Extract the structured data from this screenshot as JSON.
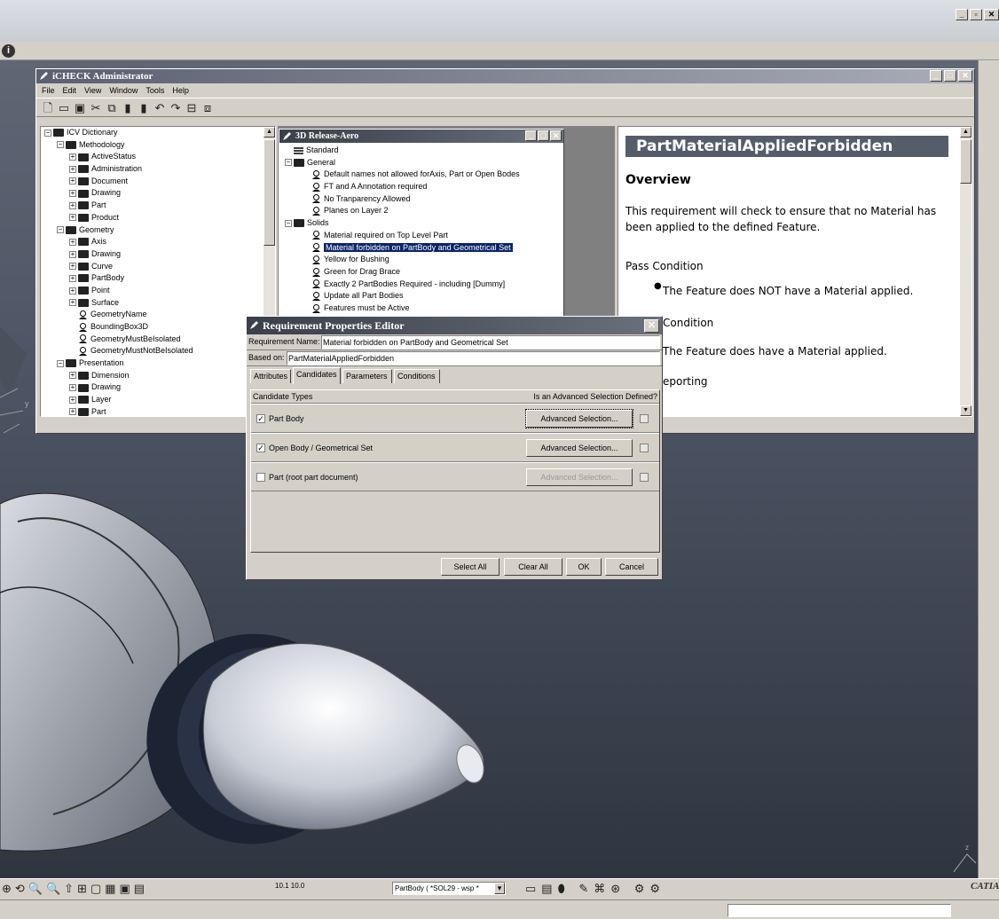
{
  "admin": {
    "title": "iCHECK Administrator",
    "menu": [
      "File",
      "Edit",
      "View",
      "Window",
      "Tools",
      "Help"
    ],
    "tree": [
      {
        "label": "ICV Dictionary",
        "depth": 0,
        "exp": "-",
        "icon": "folder"
      },
      {
        "label": "Methodology",
        "depth": 1,
        "exp": "-",
        "icon": "folder"
      },
      {
        "label": "ActiveStatus",
        "depth": 2,
        "exp": "+",
        "icon": "folder"
      },
      {
        "label": "Administration",
        "depth": 2,
        "exp": "+",
        "icon": "folder"
      },
      {
        "label": "Document",
        "depth": 2,
        "exp": "+",
        "icon": "folder"
      },
      {
        "label": "Drawing",
        "depth": 2,
        "exp": "+",
        "icon": "folder"
      },
      {
        "label": "Part",
        "depth": 2,
        "exp": "+",
        "icon": "folder"
      },
      {
        "label": "Product",
        "depth": 2,
        "exp": "+",
        "icon": "folder"
      },
      {
        "label": "Geometry",
        "depth": 1,
        "exp": "-",
        "icon": "folder"
      },
      {
        "label": "Axis",
        "depth": 2,
        "exp": "+",
        "icon": "folder"
      },
      {
        "label": "Drawing",
        "depth": 2,
        "exp": "+",
        "icon": "folder"
      },
      {
        "label": "Curve",
        "depth": 2,
        "exp": "+",
        "icon": "folder"
      },
      {
        "label": "PartBody",
        "depth": 2,
        "exp": "+",
        "icon": "folder"
      },
      {
        "label": "Point",
        "depth": 2,
        "exp": "+",
        "icon": "folder"
      },
      {
        "label": "Surface",
        "depth": 2,
        "exp": "+",
        "icon": "folder"
      },
      {
        "label": "GeometryName",
        "depth": 2,
        "exp": "",
        "icon": "req"
      },
      {
        "label": "BoundingBox3D",
        "depth": 2,
        "exp": "",
        "icon": "req"
      },
      {
        "label": "GeometryMustBeIsolated",
        "depth": 2,
        "exp": "",
        "icon": "req"
      },
      {
        "label": "GeometryMustNotBeIsolated",
        "depth": 2,
        "exp": "",
        "icon": "req"
      },
      {
        "label": "Presentation",
        "depth": 1,
        "exp": "-",
        "icon": "folder"
      },
      {
        "label": "Dimension",
        "depth": 2,
        "exp": "+",
        "icon": "folder"
      },
      {
        "label": "Drawing",
        "depth": 2,
        "exp": "+",
        "icon": "folder"
      },
      {
        "label": "Layer",
        "depth": 2,
        "exp": "+",
        "icon": "folder"
      },
      {
        "label": "Part",
        "depth": 2,
        "exp": "+",
        "icon": "folder"
      }
    ]
  },
  "release": {
    "title": "3D Release-Aero",
    "tree": [
      {
        "label": "Standard",
        "depth": 0,
        "exp": "",
        "icon": "std"
      },
      {
        "label": "General",
        "depth": 0,
        "exp": "-",
        "icon": "folder"
      },
      {
        "label": "Default names not allowed forAxis, Part or Open Bodes",
        "depth": 1,
        "exp": "",
        "icon": "req"
      },
      {
        "label": "FT and A Annotation required",
        "depth": 1,
        "exp": "",
        "icon": "req"
      },
      {
        "label": "No Tranparency Allowed",
        "depth": 1,
        "exp": "",
        "icon": "req"
      },
      {
        "label": "Planes on Layer 2",
        "depth": 1,
        "exp": "",
        "icon": "req"
      },
      {
        "label": "Solids",
        "depth": 0,
        "exp": "-",
        "icon": "folder"
      },
      {
        "label": "Material required on Top Level Part",
        "depth": 1,
        "exp": "",
        "icon": "req"
      },
      {
        "label": "Material forbidden on PartBody and Geometrical Set",
        "depth": 1,
        "exp": "",
        "icon": "req",
        "selected": true
      },
      {
        "label": "Yellow for Bushing",
        "depth": 1,
        "exp": "",
        "icon": "req"
      },
      {
        "label": "Green for Drag Brace",
        "depth": 1,
        "exp": "",
        "icon": "req"
      },
      {
        "label": "Exactly 2 PartBodies Required - including [Dummy]",
        "depth": 1,
        "exp": "",
        "icon": "req"
      },
      {
        "label": "Update all Part Bodies",
        "depth": 1,
        "exp": "",
        "icon": "req"
      },
      {
        "label": "Features must be Active",
        "depth": 1,
        "exp": "",
        "icon": "req"
      }
    ]
  },
  "doc": {
    "heading": "PartMaterialAppliedForbidden",
    "overview": "Overview",
    "description": "This requirement will check to ensure that no Material has been applied to the defined Feature.",
    "pass_label": "Pass Condition",
    "pass_text": "The Feature does NOT have a Material applied.",
    "fail_label": "Condition",
    "fail_text": "The Feature does have a Material applied.",
    "reporting_label": "eporting"
  },
  "editor": {
    "title": "Requirement Properties Editor",
    "req_name_label": "Requirement Name:",
    "req_name_value": "Material forbidden on PartBody and Geometrical Set",
    "based_on_label": "Based on:",
    "based_on_value": "PartMaterialAppliedForbidden",
    "tabs": [
      "Attributes",
      "Candidates",
      "Parameters",
      "Conditions"
    ],
    "active_tab": "Candidates",
    "col_types": "Candidate Types",
    "col_adv": "Is an Advanced Selection Defined?",
    "candidates": [
      {
        "label": "Part Body",
        "checked": true,
        "adv_label": "Advanced Selection...",
        "adv_enabled": true,
        "defined": false
      },
      {
        "label": "Open Body / Geometrical Set",
        "checked": true,
        "adv_label": "Advanced Selection...",
        "adv_enabled": true,
        "defined": false
      },
      {
        "label": "Part (root part document)",
        "checked": false,
        "adv_label": "Advanced Selection...",
        "adv_enabled": false,
        "defined": false
      }
    ],
    "buttons": {
      "select_all": "Select All",
      "clear_all": "Clear All",
      "ok": "OK",
      "cancel": "Cancel"
    }
  },
  "catia": {
    "active_body": "PartBody ( *SOL29 - wsp *",
    "toolbar_numbers": "10.1 10.0",
    "brand": "CATIA"
  }
}
